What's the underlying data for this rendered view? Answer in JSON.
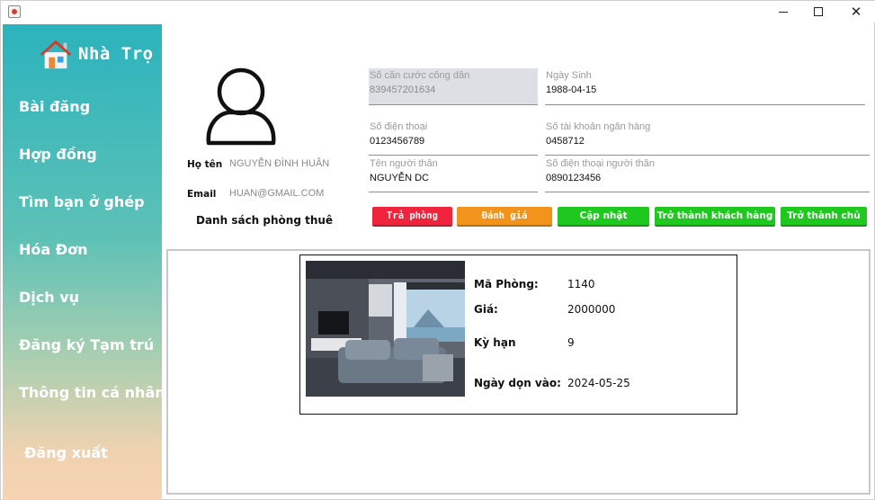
{
  "window": {
    "controls": {
      "minimize": "—",
      "maximize": "☐",
      "close": "✕"
    }
  },
  "brand": {
    "title": "Nhà Trọ",
    "icon": "house-icon"
  },
  "sidebar": {
    "items": [
      {
        "label": "Bài đăng"
      },
      {
        "label": "Hợp đồng"
      },
      {
        "label": "Tìm bạn ở ghép"
      },
      {
        "label": "Hóa Đơn"
      },
      {
        "label": "Dịch vụ"
      },
      {
        "label": "Đăng ký Tạm trú"
      },
      {
        "label": "Thông tin cá nhân"
      },
      {
        "label": "Đăng xuất"
      }
    ]
  },
  "profile": {
    "avatar_icon": "user-icon",
    "name_label": "Họ tên",
    "name_value": "NGUYỄN ĐÌNH HUÂN",
    "email_label": "Email",
    "email_value": "HUAN@GMAIL.COM",
    "rented_rooms_title": "Danh sách phòng thuê"
  },
  "fields": {
    "citizen_id": {
      "label": "Số căn cước công dân",
      "value": "839457201634"
    },
    "birthday": {
      "label": "Ngày Sinh",
      "value": "1988-04-15"
    },
    "phone": {
      "label": "Số điện thoại",
      "value": "0123456789"
    },
    "bank_account": {
      "label": "Số tài khoản ngân hàng",
      "value": "0458712"
    },
    "relative_name": {
      "label": "Tên người thân",
      "value": "NGUYỄN DC"
    },
    "relative_phone": {
      "label": "Số điện thoại người thân",
      "value": "0890123456"
    }
  },
  "buttons": {
    "return_room": "Trả phòng",
    "review": "Đánh giá",
    "update": "Cập nhật",
    "become_customer": "Trở thành khách hàng",
    "become_owner": "Trở thành chủ"
  },
  "colors": {
    "return_room": "#f0243d",
    "review": "#f2941b",
    "green": "#1ec81e",
    "sidebar_top": "#2bb3bd",
    "sidebar_bottom": "#f6d4b3"
  },
  "room": {
    "photo": "room-photo",
    "id_label": "Mã Phòng:",
    "id_value": "1140",
    "price_label": "Giá:",
    "price_value": "2000000",
    "term_label": "Kỳ hạn",
    "term_value": "9",
    "move_in_label": "Ngày dọn vào:",
    "move_in_value": "2024-05-25"
  }
}
